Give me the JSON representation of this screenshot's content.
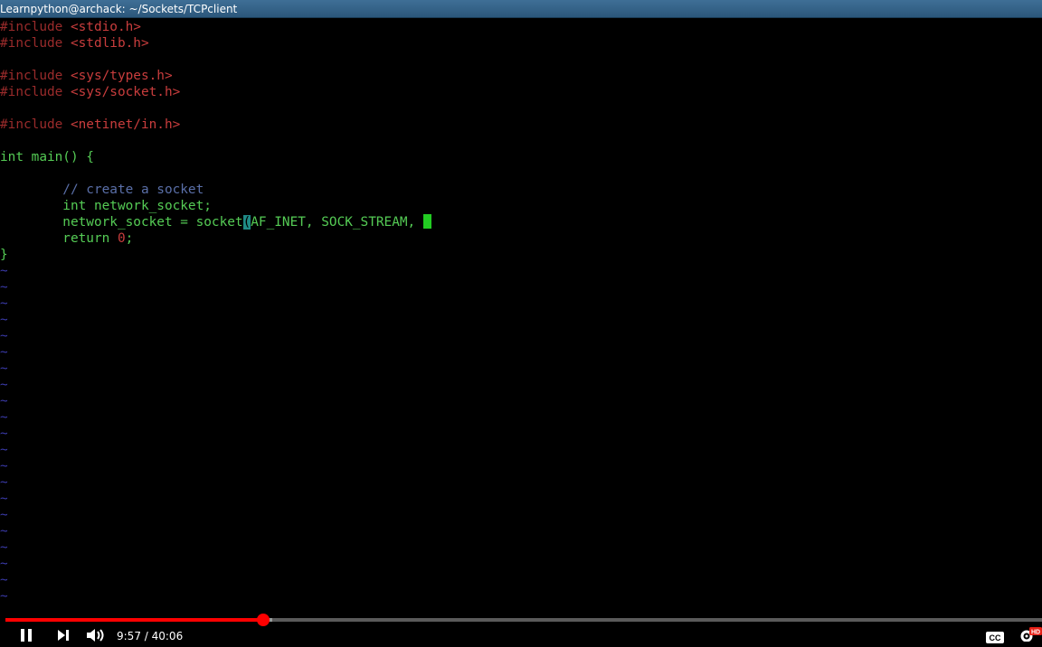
{
  "window": {
    "title": "Learnpython@archack: ~/Sockets/TCPclient"
  },
  "editor": {
    "line1": [
      "#include ",
      "<stdio.h>"
    ],
    "line2": [
      "#include ",
      "<stdlib.h>"
    ],
    "line4": [
      "#include ",
      "<sys/types.h>"
    ],
    "line5": [
      "#include ",
      "<sys/socket.h>"
    ],
    "line7": [
      "#include ",
      "<netinet/in.h>"
    ],
    "line9": "int main() {",
    "line11": "        // create a socket",
    "line12": "        int network_socket;",
    "line13": {
      "before": "        network_socket = socket",
      "paren": "(",
      "after": "AF_INET, SOCK_STREAM, "
    },
    "line14": {
      "keyword": "        return ",
      "number": "0",
      "semi": ";"
    },
    "line15": "}",
    "empty_line_marker": "~"
  },
  "player": {
    "time_display": "9:57 / 40:06",
    "progress_fraction": 0.2485,
    "buffered_fraction": 0.2575,
    "cc_label": "CC",
    "hd_badge": "HD"
  },
  "colors": {
    "played": "#ff0000",
    "titlebar": "#2b577b"
  },
  "icons": [
    "pause-icon",
    "next-icon",
    "volume-icon",
    "captions-icon",
    "settings-icon"
  ]
}
